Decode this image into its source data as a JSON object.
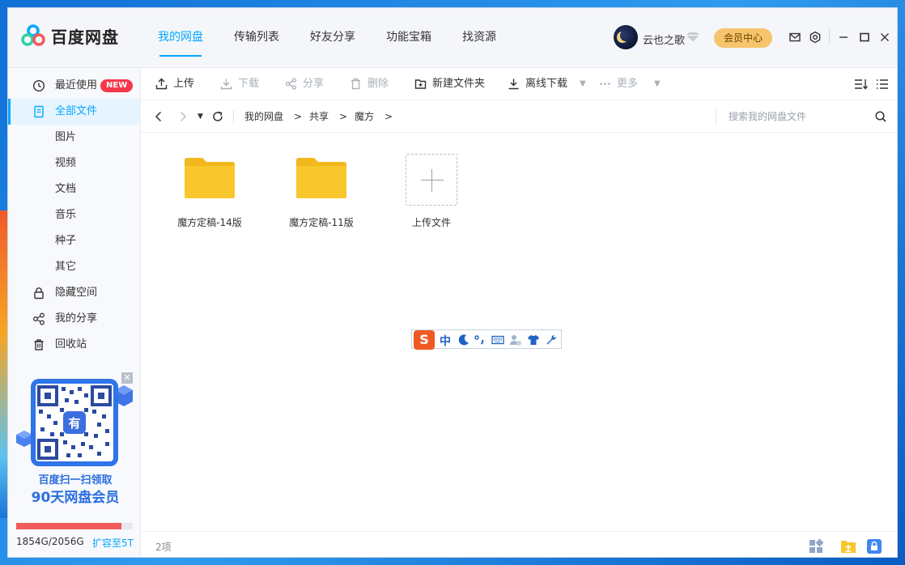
{
  "app": {
    "brand": "百度网盘"
  },
  "nav": [
    "我的网盘",
    "传输列表",
    "好友分享",
    "功能宝箱",
    "找资源"
  ],
  "user": {
    "name": "云也之歌",
    "vip_button": "会员中心"
  },
  "sidebar": {
    "items": [
      {
        "label": "最近使用",
        "badge": "NEW"
      },
      {
        "label": "全部文件"
      },
      {
        "label": "图片"
      },
      {
        "label": "视频"
      },
      {
        "label": "文档"
      },
      {
        "label": "音乐"
      },
      {
        "label": "种子"
      },
      {
        "label": "其它"
      },
      {
        "label": "隐藏空间"
      },
      {
        "label": "我的分享"
      },
      {
        "label": "回收站"
      }
    ],
    "promo": {
      "line1": "百度扫一扫领取",
      "line2": "90天网盘会员",
      "close": "✕"
    },
    "storage": {
      "used_text": "1854G/2056G",
      "expand": "扩容至5T",
      "used_fraction": 0.9
    }
  },
  "toolbar": {
    "upload": "上传",
    "download": "下载",
    "share": "分享",
    "delete": "删除",
    "new_folder": "新建文件夹",
    "offline_download": "离线下载",
    "more": "更多"
  },
  "breadcrumb": [
    "我的网盘",
    "共享",
    "魔方"
  ],
  "search": {
    "placeholder": "搜索我的网盘文件"
  },
  "files": [
    {
      "name": "魔方定稿-14版"
    },
    {
      "name": "魔方定稿-11版"
    }
  ],
  "upload_tile": {
    "label": "上传文件"
  },
  "ime": {
    "logo": "S",
    "mode": "中"
  },
  "status": {
    "count": "2项"
  },
  "colors": {
    "accent": "#06a7ff",
    "folder": "#f8c72c",
    "vip": "#f6c46b",
    "badge": "#f5384a"
  }
}
